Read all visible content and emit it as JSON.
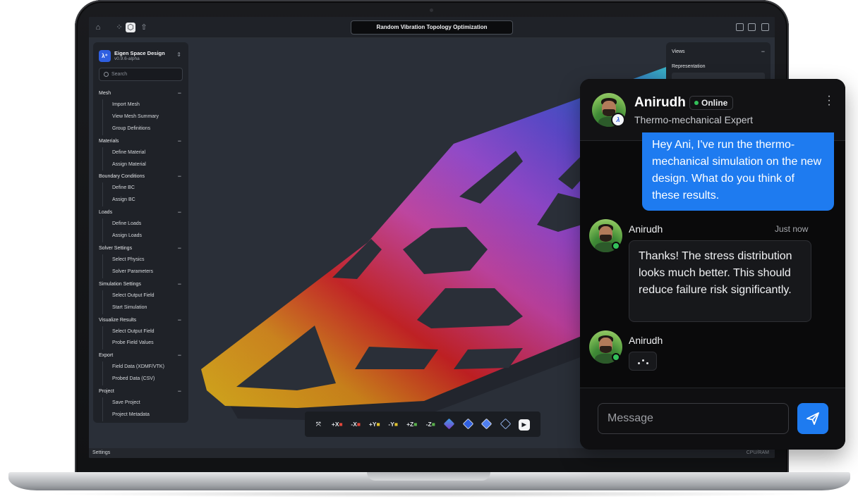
{
  "app": {
    "title": "Random Vibration Topology Optimization"
  },
  "sidebar": {
    "brand_name": "Eigen Space Design",
    "brand_version": "v0.9.6-alpha",
    "search_placeholder": "Search",
    "groups": [
      {
        "label": "Mesh",
        "items": [
          "Import Mesh",
          "View Mesh Summary",
          "Group Definitions"
        ]
      },
      {
        "label": "Materials",
        "items": [
          "Define Material",
          "Assign Material"
        ]
      },
      {
        "label": "Boundary Conditions",
        "items": [
          "Define BC",
          "Assign BC"
        ]
      },
      {
        "label": "Loads",
        "items": [
          "Define Loads",
          "Assign Loads"
        ]
      },
      {
        "label": "Solver Settings",
        "items": [
          "Select Physics",
          "Solver Parameters"
        ]
      },
      {
        "label": "Simulation Settings",
        "items": [
          "Select Output Field",
          "Start Simulation"
        ]
      },
      {
        "label": "Visualize Results",
        "items": [
          "Select Output Field",
          "Probe Field Values"
        ]
      },
      {
        "label": "Export",
        "items": [
          "Field Data (XDMF/VTK)",
          "Probed Data (CSV)"
        ]
      },
      {
        "label": "Project",
        "items": [
          "Save Project",
          "Project Metadata"
        ]
      }
    ]
  },
  "right_panel": {
    "title": "Views",
    "subtitle": "Representation"
  },
  "toolbar": {
    "axes": [
      "+X",
      "-X",
      "+Y",
      "-Y",
      "+Z",
      "-Z"
    ]
  },
  "status": {
    "left": "Settings",
    "right": "CPU/RAM"
  },
  "chat": {
    "name": "Anirudh",
    "status": "Online",
    "role": "Thermo-mechanical Expert",
    "outgoing": "Hey Ani, I've run the thermo-mechanical simulation on the new design. What do you think of these results.",
    "incoming_name": "Anirudh",
    "incoming_time": "Just now",
    "incoming": "Thanks! The stress distribution looks much better. This should reduce failure risk significantly.",
    "typing_name": "Anirudh",
    "input_placeholder": "Message"
  },
  "colors": {
    "accent": "#1e7bf0",
    "online": "#33c15a",
    "brand": "#2f5fe0"
  }
}
